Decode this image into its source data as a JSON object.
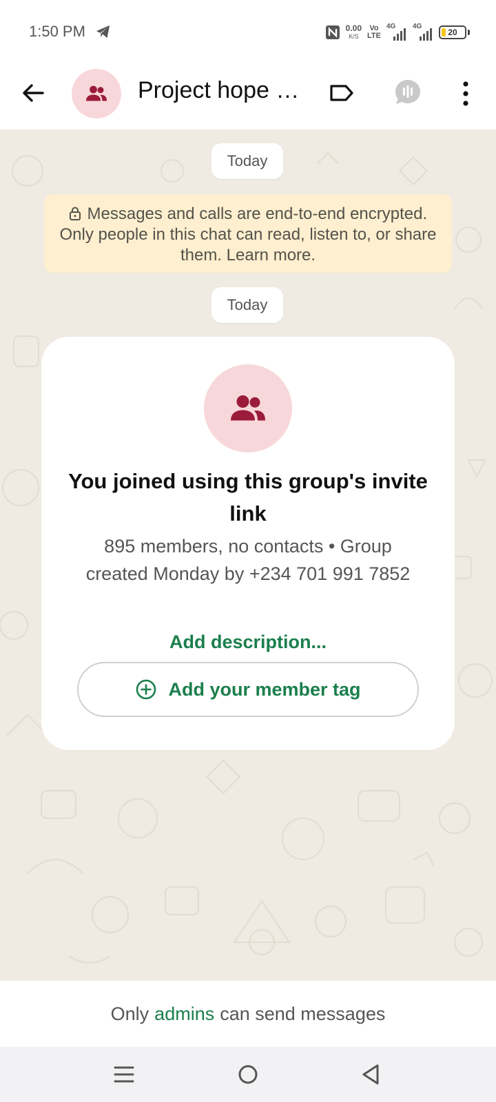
{
  "status_bar": {
    "time": "1:50 PM",
    "net_speed_value": "0.00",
    "net_speed_unit": "K/S",
    "volte_top": "Vo",
    "volte_bottom": "LTE",
    "signal1_tag": "4G",
    "signal2_tag": "4G",
    "battery_level": "20",
    "icons": [
      "telegram-icon",
      "nfc-icon",
      "signal-icon",
      "battery-icon"
    ]
  },
  "header": {
    "title": "Project hope p...",
    "icons": [
      "back-arrow-icon",
      "group-icon",
      "label-icon",
      "audio-chat-icon",
      "more-vert-icon"
    ]
  },
  "chat": {
    "date_chip_1": "Today",
    "encryption_notice": "Messages and calls are end-to-end encrypted. Only people in this chat can read, listen to, or share them. Learn more.",
    "date_chip_2": "Today",
    "info_card": {
      "title": "You joined using this group's invite link",
      "details": "895 members, no contacts • Group created Monday by +234 701 991 7852",
      "add_description": "Add description...",
      "member_tag_button": "Add your member tag"
    }
  },
  "footer": {
    "notice_prefix": "Only",
    "notice_link": "admins",
    "notice_suffix": "can send messages"
  },
  "colors": {
    "accent_green": "#1b7f4d",
    "group_avatar_bg": "#f8d7da",
    "group_icon": "#9b1b3a",
    "chat_bg": "#efeae2",
    "encryption_bg": "#fdefcf"
  }
}
